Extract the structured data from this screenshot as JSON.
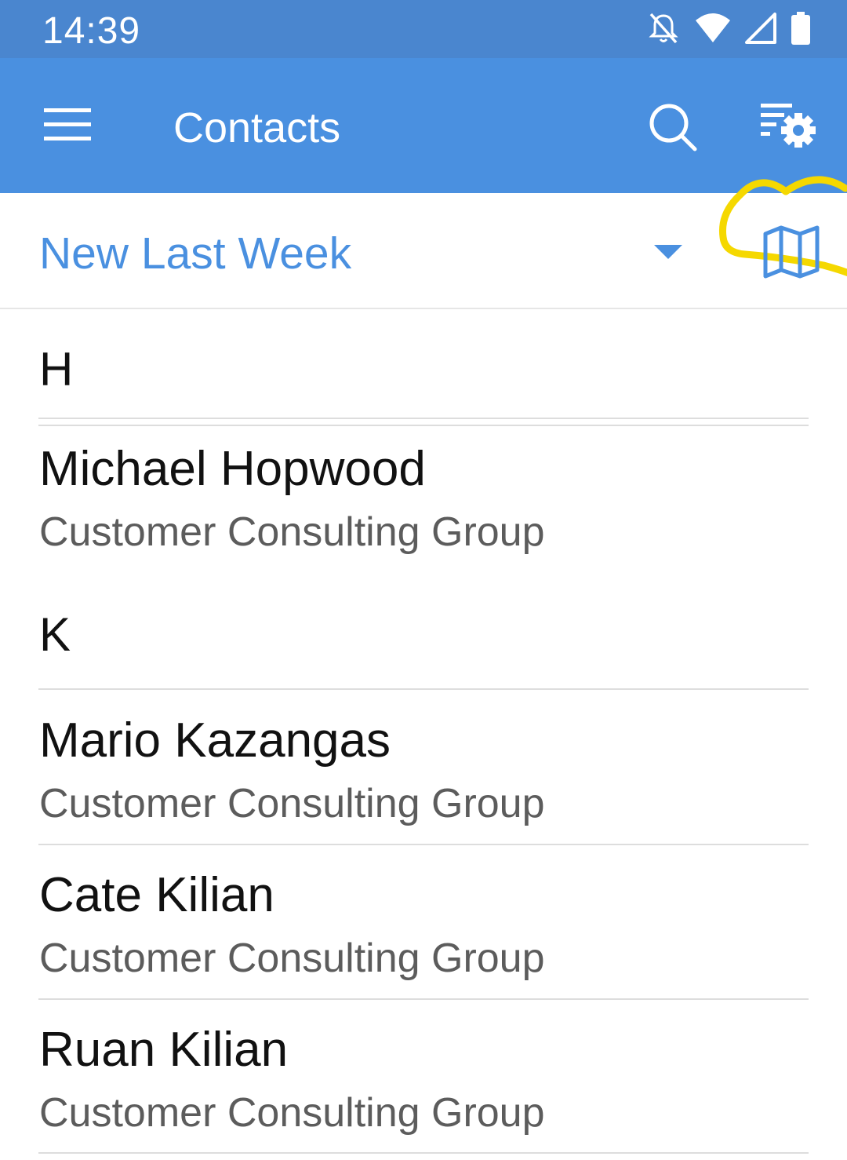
{
  "status_bar": {
    "time": "14:39",
    "icons": [
      "notifications-off-icon",
      "wifi-icon",
      "signal-icon",
      "battery-icon"
    ]
  },
  "app_bar": {
    "title": "Contacts",
    "menu_icon": "hamburger-menu-icon",
    "search_icon": "search-icon",
    "settings_icon": "filter-settings-icon",
    "color": "#4a90e0"
  },
  "filter": {
    "selected": "New Last Week",
    "dropdown_icon": "triangle-down-icon",
    "map_icon": "map-icon",
    "highlight_color": "#f5d800"
  },
  "contacts": {
    "sections": [
      {
        "letter": "H",
        "items": [
          {
            "name": "Michael Hopwood",
            "company": "Customer Consulting Group"
          }
        ]
      },
      {
        "letter": "K",
        "items": [
          {
            "name": "Mario Kazangas",
            "company": "Customer Consulting Group"
          },
          {
            "name": "Cate Kilian",
            "company": "Customer Consulting Group"
          },
          {
            "name": "Ruan Kilian",
            "company": "Customer Consulting Group"
          }
        ]
      }
    ]
  }
}
